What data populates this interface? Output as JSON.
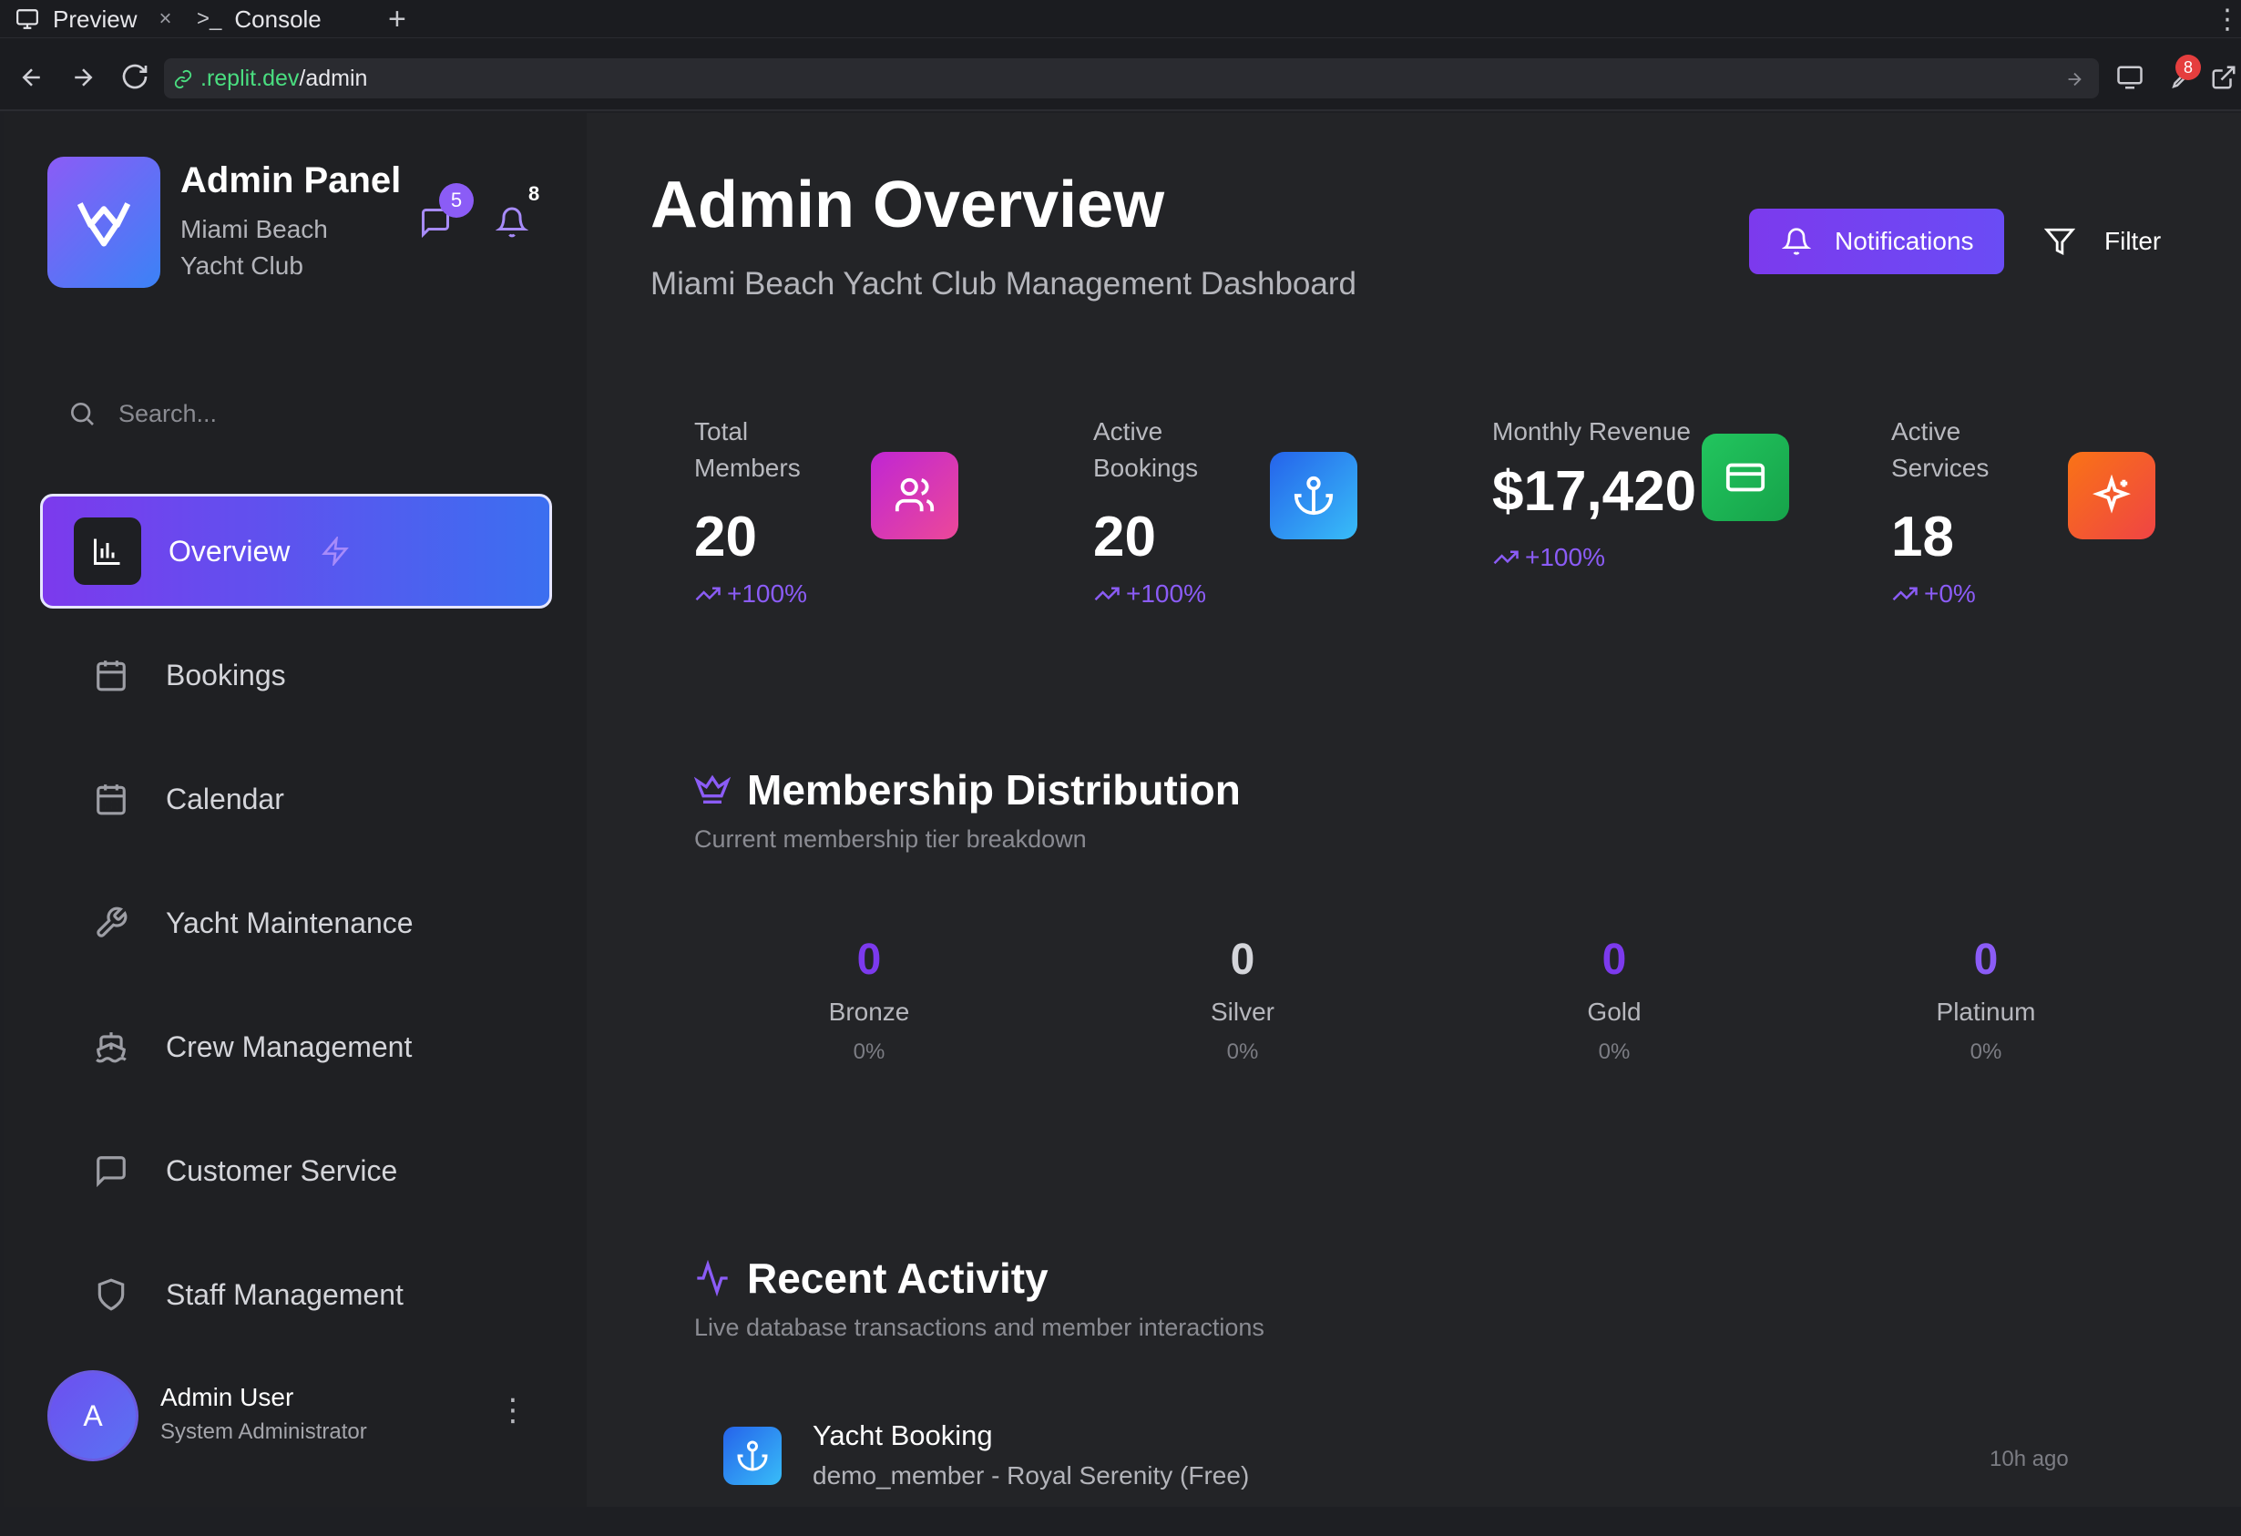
{
  "browser": {
    "tabs": [
      {
        "label": "Preview"
      },
      {
        "label": "Console"
      }
    ],
    "url_host": ".replit.dev",
    "url_path": "/admin",
    "devtools_badge": "8"
  },
  "brand": {
    "title": "Admin Panel",
    "subtitle": "Miami Beach Yacht Club",
    "messages_count": "5",
    "alerts_count": "8"
  },
  "search": {
    "placeholder": "Search..."
  },
  "nav": [
    {
      "label": "Overview",
      "icon": "bar-chart-icon"
    },
    {
      "label": "Bookings",
      "icon": "calendar-icon"
    },
    {
      "label": "Calendar",
      "icon": "calendar-grid-icon"
    },
    {
      "label": "Yacht Maintenance",
      "icon": "wrench-icon"
    },
    {
      "label": "Crew Management",
      "icon": "ship-icon"
    },
    {
      "label": "Customer Service",
      "icon": "message-square-icon"
    },
    {
      "label": "Staff Management",
      "icon": "shield-icon"
    }
  ],
  "user": {
    "initial": "A",
    "name": "Admin User",
    "role": "System Administrator"
  },
  "header": {
    "title": "Admin Overview",
    "subtitle": "Miami Beach Yacht Club Management Dashboard",
    "notifications_label": "Notifications",
    "filter_label": "Filter"
  },
  "stats": [
    {
      "label_1": "Total",
      "label_2": "Members",
      "value": "20",
      "change": "+100%",
      "icon": "users-icon",
      "color": "#d946ef"
    },
    {
      "label_1": "Active",
      "label_2": "Bookings",
      "value": "20",
      "change": "+100%",
      "icon": "anchor-icon",
      "color": "#3b82f6"
    },
    {
      "label_1": "Monthly Revenue",
      "label_2": "",
      "value": "$17,420",
      "change": "+100%",
      "icon": "credit-card-icon",
      "color": "#22c55e"
    },
    {
      "label_1": "Active",
      "label_2": "Services",
      "value": "18",
      "change": "+0%",
      "icon": "sparkles-icon",
      "color": "#f97316"
    }
  ],
  "membership": {
    "title": "Membership Distribution",
    "subtitle": "Current membership tier breakdown",
    "tiers": [
      {
        "count": "0",
        "name": "Bronze",
        "pct": "0%"
      },
      {
        "count": "0",
        "name": "Silver",
        "pct": "0%"
      },
      {
        "count": "0",
        "name": "Gold",
        "pct": "0%"
      },
      {
        "count": "0",
        "name": "Platinum",
        "pct": "0%"
      }
    ]
  },
  "activity": {
    "title": "Recent Activity",
    "subtitle": "Live database transactions and member interactions",
    "items": [
      {
        "title": "Yacht Booking",
        "detail": "demo_member - Royal Serenity (Free)",
        "time": "10h ago",
        "icon": "anchor-icon"
      }
    ]
  },
  "colors": {
    "accent": "#7c3aed",
    "accent_blue": "#3b6ff0",
    "background": "#232427",
    "sidebar": "#1f2023"
  }
}
